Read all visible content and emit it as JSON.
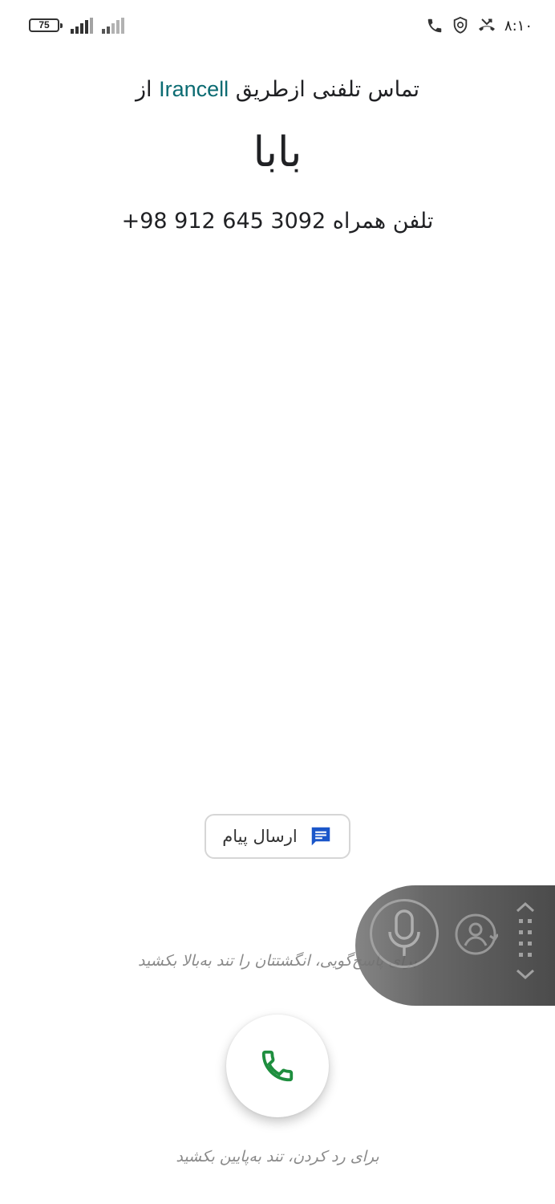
{
  "status_bar": {
    "battery_level": "75",
    "time": "۸:۱۰",
    "icons": [
      "battery-icon",
      "signal-icon",
      "signal-icon",
      "phone-icon",
      "shield-icon",
      "missed-call-icon"
    ]
  },
  "call": {
    "via_prefix": "تماس تلفنی ازطریق",
    "carrier": "Irancell",
    "via_suffix": "از",
    "caller_name": "بابا",
    "number_label": "تلفن همراه",
    "number": "+98 912 645 3092"
  },
  "actions": {
    "send_message_label": "ارسال پیام",
    "answer_hint": "برای پاسخ‌گویی، انگشتتان را تند به‌بالا بکشید",
    "decline_hint": "برای رد کردن، تند به‌پایین بکشید"
  },
  "floating_panel": {
    "icons": [
      "microphone-icon",
      "user-sync-icon",
      "drag-handle-icon"
    ]
  },
  "colors": {
    "carrier_accent": "#0b6b72",
    "answer_green": "#1e8e3e",
    "message_icon_blue": "#1a56c9",
    "hint_gray": "#8a8a8a"
  }
}
